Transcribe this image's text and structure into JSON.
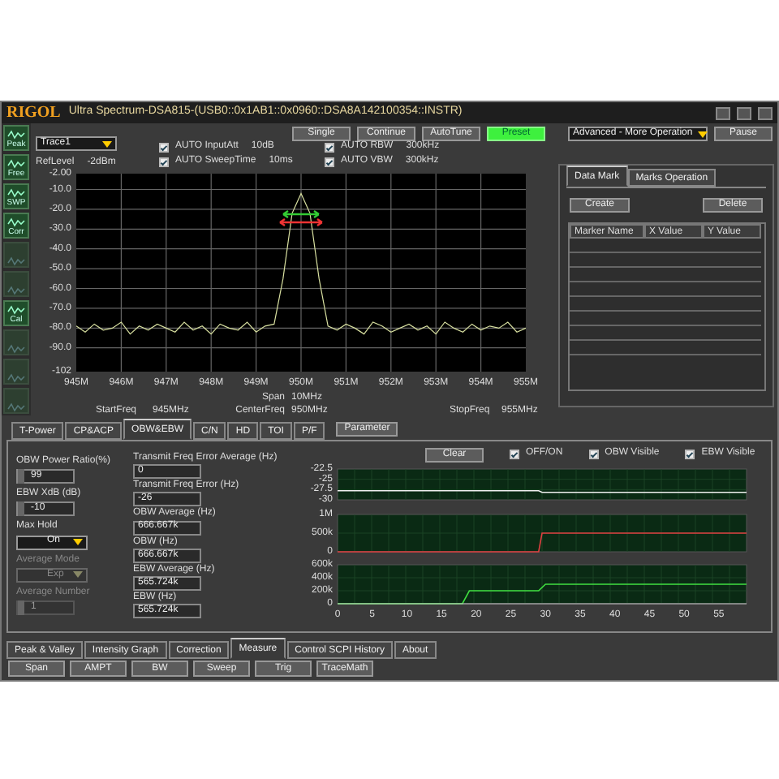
{
  "window": {
    "logo": "RIGOL",
    "title": "Ultra Spectrum-DSA815-(USB0::0x1AB1::0x0960::DSA8A142100354::INSTR)"
  },
  "sidebar": {
    "items": [
      {
        "label": "Peak",
        "disabled": false
      },
      {
        "label": "Free",
        "disabled": false
      },
      {
        "label": "SWP",
        "disabled": false
      },
      {
        "label": "Corr",
        "disabled": false
      },
      {
        "disabled": true
      },
      {
        "disabled": true
      },
      {
        "label": "Cal",
        "disabled": false
      },
      {
        "disabled": true
      },
      {
        "disabled": true
      },
      {
        "disabled": true
      }
    ]
  },
  "toolbar": {
    "trace_select": "Trace1",
    "ref_level_label": "RefLevel",
    "ref_level": "-2dBm",
    "auto_settings": [
      {
        "label": "AUTO InputAtt",
        "value": "10dB",
        "checked": true
      },
      {
        "label": "AUTO RBW",
        "value": "300kHz",
        "checked": true
      },
      {
        "label": "AUTO SweepTime",
        "value": "10ms",
        "checked": true
      },
      {
        "label": "AUTO VBW",
        "value": "300kHz",
        "checked": true
      }
    ],
    "buttons": [
      {
        "label": "Single",
        "highlighted": false
      },
      {
        "label": "Continue",
        "highlighted": false
      },
      {
        "label": "AutoTune",
        "highlighted": false
      },
      {
        "label": "Preset",
        "highlighted": true
      }
    ],
    "operation_select": "Advanced - More Operation",
    "pause_button": "Pause"
  },
  "chart": {
    "chart_data": {
      "type": "line",
      "grid": true,
      "xlim": [
        945,
        955
      ],
      "ylim": [
        -102,
        -2
      ],
      "yticks": [
        {
          "value": -2,
          "label": "-2.00"
        },
        {
          "value": -10,
          "label": "-10.0"
        },
        {
          "value": -20,
          "label": "-20.0"
        },
        {
          "value": -30,
          "label": "-30.0"
        },
        {
          "value": -40,
          "label": "-40.0"
        },
        {
          "value": -50,
          "label": "-50.0"
        },
        {
          "value": -60,
          "label": "-60.0"
        },
        {
          "value": -70,
          "label": "-70.0"
        },
        {
          "value": -80,
          "label": "-80.0"
        },
        {
          "value": -90,
          "label": "-90.0"
        },
        {
          "value": -102,
          "label": "-102"
        }
      ],
      "xticks": [
        {
          "value": 945,
          "label": "945M"
        },
        {
          "value": 946,
          "label": "946M"
        },
        {
          "value": 947,
          "label": "947M"
        },
        {
          "value": 948,
          "label": "948M"
        },
        {
          "value": 949,
          "label": "949M"
        },
        {
          "value": 950,
          "label": "950M"
        },
        {
          "value": 951,
          "label": "951M"
        },
        {
          "value": 952,
          "label": "952M"
        },
        {
          "value": 953,
          "label": "953M"
        },
        {
          "value": 954,
          "label": "954M"
        },
        {
          "value": 955,
          "label": "955M"
        }
      ],
      "x": [
        945,
        945.2,
        945.4,
        945.6,
        945.8,
        946,
        946.2,
        946.4,
        946.6,
        946.8,
        947,
        947.2,
        947.4,
        947.6,
        947.8,
        948,
        948.2,
        948.4,
        948.6,
        948.8,
        949,
        949.2,
        949.4,
        949.6,
        949.8,
        950,
        950.2,
        950.4,
        950.6,
        950.8,
        951,
        951.2,
        951.4,
        951.6,
        951.8,
        952,
        952.2,
        952.4,
        952.6,
        952.8,
        953,
        953.2,
        953.4,
        953.6,
        953.8,
        954,
        954.2,
        954.4,
        954.6,
        954.8,
        955
      ],
      "series": [
        {
          "color": "#d8e0a0",
          "values": [
            -79,
            -82,
            -78,
            -81,
            -80,
            -77,
            -83,
            -79,
            -81,
            -78,
            -80,
            -82,
            -77,
            -81,
            -79,
            -83,
            -78,
            -80,
            -81,
            -77,
            -82,
            -79,
            -78,
            -55,
            -22,
            -12,
            -22,
            -55,
            -79,
            -81,
            -78,
            -80,
            -83,
            -77,
            -79,
            -82,
            -80,
            -78,
            -81,
            -79,
            -83,
            -77,
            -80,
            -82,
            -78,
            -81,
            -79,
            -80,
            -77,
            -82,
            -80
          ]
        }
      ]
    },
    "span_label": "Span",
    "span": "10MHz",
    "center_label": "CenterFreq",
    "center": "950MHz",
    "start_label": "StartFreq",
    "start": "945MHz",
    "stop_label": "StopFreq",
    "stop": "955MHz"
  },
  "marker_panel": {
    "tabs": [
      {
        "label": "Data Mark",
        "selected": true
      },
      {
        "label": "Marks Operation",
        "selected": false
      }
    ],
    "buttons": [
      "Create",
      "Delete"
    ],
    "table": {
      "columns": [
        "Marker Name",
        "X Value",
        "Y Value"
      ]
    }
  },
  "measure": {
    "tabs": [
      {
        "label": "T-Power",
        "selected": false
      },
      {
        "label": "CP&ACP",
        "selected": false
      },
      {
        "label": "OBW&EBW",
        "selected": true
      },
      {
        "label": "C/N",
        "selected": false
      },
      {
        "label": "HD",
        "selected": false
      },
      {
        "label": "TOI",
        "selected": false
      },
      {
        "label": "P/F",
        "selected": false
      }
    ],
    "parameter_button": "Parameter",
    "settings": [
      {
        "kind": "spin",
        "label": "OBW Power Ratio(%)",
        "value": "99",
        "disabled": false
      },
      {
        "kind": "spin",
        "label": "EBW XdB (dB)",
        "value": "-10",
        "disabled": false
      },
      {
        "kind": "select",
        "label": "Max Hold",
        "value": "On",
        "disabled": false
      },
      {
        "kind": "select",
        "label": "Average Mode",
        "value": "Exp",
        "disabled": true
      },
      {
        "kind": "spin",
        "label": "Average Number",
        "value": "1",
        "disabled": true
      }
    ],
    "results": [
      {
        "label": "Transmit Freq Error Average (Hz)",
        "value": "0"
      },
      {
        "label": "Transmit Freq Error (Hz)",
        "value": "-26"
      },
      {
        "label": "OBW Average (Hz)",
        "value": "666.667k"
      },
      {
        "label": "OBW (Hz)",
        "value": "666.667k"
      },
      {
        "label": "EBW Average (Hz)",
        "value": "565.724k"
      },
      {
        "label": "EBW (Hz)",
        "value": "565.724k"
      }
    ],
    "clear_button": "Clear",
    "toggles": [
      {
        "label": "OFF/ON",
        "checked": true
      },
      {
        "label": "OBW Visible",
        "checked": true
      },
      {
        "label": "EBW Visible",
        "checked": true
      }
    ],
    "graphs": [
      {
        "chart_data": {
          "type": "line",
          "xlim": [
            0,
            59
          ],
          "grid": true,
          "ylim": [
            -30,
            -22.5
          ],
          "yticks": [
            {
              "value": -22.5,
              "label": "-22.5"
            },
            {
              "value": -25,
              "label": "-25"
            },
            {
              "value": -27.5,
              "label": "-27.5"
            },
            {
              "value": -30,
              "label": "-30"
            }
          ],
          "x": [
            0,
            29,
            29.5,
            59
          ],
          "series": [
            {
              "color": "#f0f0f0",
              "values": [
                -27.8,
                -27.8,
                -28.2,
                -28.2
              ]
            }
          ]
        }
      },
      {
        "chart_data": {
          "type": "line",
          "xlim": [
            0,
            59
          ],
          "grid": true,
          "ylim": [
            0,
            1000000
          ],
          "yticks": [
            {
              "value": 1000000,
              "label": "1M"
            },
            {
              "value": 500000,
              "label": "500k"
            },
            {
              "value": 0,
              "label": "0"
            }
          ],
          "x": [
            0,
            29,
            29.5,
            59
          ],
          "series": [
            {
              "color": "#e04040",
              "values": [
                0,
                0,
                500000,
                500000
              ]
            }
          ]
        }
      },
      {
        "chart_data": {
          "type": "line",
          "xlim": [
            0,
            59
          ],
          "grid": true,
          "ylim": [
            0,
            600000
          ],
          "yticks": [
            {
              "value": 600000,
              "label": "600k"
            },
            {
              "value": 400000,
              "label": "400k"
            },
            {
              "value": 200000,
              "label": "200k"
            },
            {
              "value": 0,
              "label": "0"
            }
          ],
          "xticks": [
            0,
            5,
            10,
            15,
            20,
            25,
            30,
            35,
            40,
            45,
            50,
            55
          ],
          "x": [
            0,
            18,
            19,
            29,
            30,
            59
          ],
          "series": [
            {
              "color": "#40e040",
              "values": [
                0,
                0,
                200000,
                200000,
                300000,
                300000
              ]
            }
          ]
        }
      }
    ]
  },
  "bottom_tabs": [
    {
      "label": "Peak & Valley",
      "selected": false
    },
    {
      "label": "Intensity Graph",
      "selected": false
    },
    {
      "label": "Correction",
      "selected": false
    },
    {
      "label": "Measure",
      "selected": true
    },
    {
      "label": "Control SCPI History",
      "selected": false
    },
    {
      "label": "About",
      "selected": false
    }
  ],
  "bottom_buttons": [
    "Span",
    "AMPT",
    "BW",
    "Sweep",
    "Trig",
    "TraceMath"
  ]
}
